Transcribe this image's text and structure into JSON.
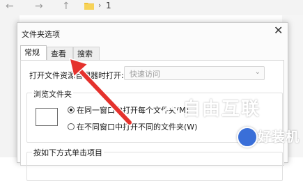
{
  "explorer": {
    "back": "←",
    "forward": "→",
    "up": "↑",
    "path_sep": "›",
    "path_item": "1"
  },
  "dialog": {
    "title": "文件夹选项",
    "close": "✕",
    "tabs": [
      {
        "label": "常规"
      },
      {
        "label": "查看"
      },
      {
        "label": "搜索"
      }
    ],
    "open_label": "打开文件资源管理器时打开:",
    "open_value": "快速访问",
    "browse_group": "浏览文件夹",
    "radio_same": "在同一窗口中打开每个文件夹(M)",
    "radio_diff": "在不同窗口中打开不同的文件夹(W)",
    "click_group": "按如下方式单击项目"
  },
  "watermark": {
    "brand": "自由互联",
    "badge": "好装机"
  }
}
